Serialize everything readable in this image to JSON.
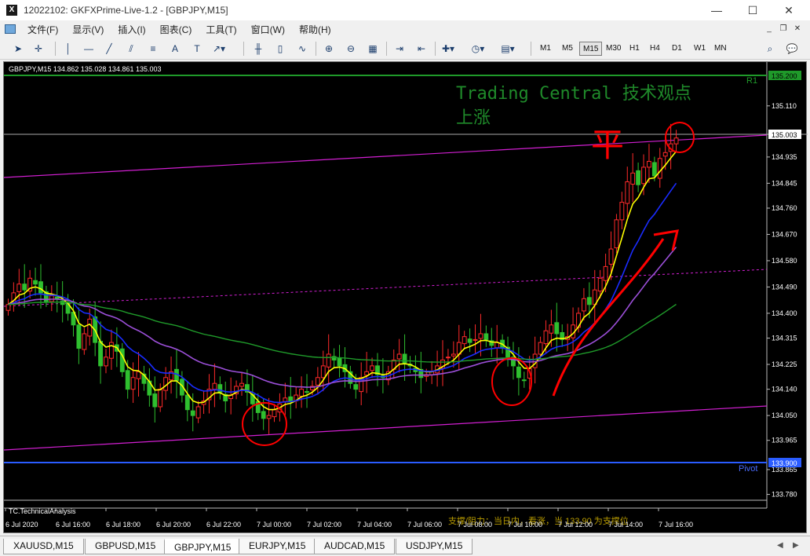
{
  "window": {
    "title": "12022102: GKFXPrime-Live-1.2 - [GBPJPY,M15]",
    "app_icon": "X",
    "minimize": "—",
    "maximize": "☐",
    "close": "✕"
  },
  "menu": [
    "文件(F)",
    "显示(V)",
    "插入(I)",
    "图表(C)",
    "工具(T)",
    "窗口(W)",
    "帮助(H)"
  ],
  "toolbar": {
    "timeframes": [
      "M1",
      "M5",
      "M15",
      "M30",
      "H1",
      "H4",
      "D1",
      "W1",
      "MN"
    ],
    "active_timeframe": "M15",
    "tool_labels": [
      "A",
      "T"
    ]
  },
  "chart": {
    "symbol_line": "GBPJPY,M15  134.862 135.028 134.861 135.003",
    "overlay_title": "Trading Central 技术观点",
    "overlay_subtitle": "上涨",
    "handwritten_note": "平",
    "indicator_label": "TC.TechnicalAnalysis",
    "bottom_overlay_text": "支撑/阻力：当日内，看涨，当 133.90 为支撑位",
    "r1_label": "R1",
    "r1_value": "135.200",
    "pivot_label": "Pivot",
    "pivot_value": "133.900",
    "current_price": "135.003",
    "colors": {
      "background": "#000000",
      "candle_up": "#ff2a2a",
      "candle_down": "#2fbf2f",
      "ma_fast": "#ffff00",
      "ma_mid": "#1a2cff",
      "ma_slow": "#9b4fd8",
      "ma_long": "#1f9a2a",
      "channel": "#d21fd2",
      "r1_line": "#1f9a2a",
      "pivot_line": "#2a5cff",
      "annotation": "#ff0000",
      "overlay_text": "#1f8a2a"
    }
  },
  "chart_data": {
    "type": "candlestick",
    "title": "GBPJPY,M15",
    "y_ticks": [
      "135.110",
      "134.935",
      "134.845",
      "134.760",
      "134.670",
      "134.580",
      "134.490",
      "134.400",
      "134.315",
      "134.225",
      "134.140",
      "134.050",
      "133.965",
      "133.865",
      "133.780"
    ],
    "x_ticks": [
      "6 Jul 2020",
      "6 Jul 16:00",
      "6 Jul 18:00",
      "6 Jul 20:00",
      "6 Jul 22:00",
      "7 Jul 00:00",
      "7 Jul 02:00",
      "7 Jul 04:00",
      "7 Jul 06:00",
      "7 Jul 08:00",
      "7 Jul 10:00",
      "7 Jul 12:00",
      "7 Jul 14:00",
      "7 Jul 16:00"
    ],
    "ylim": [
      133.76,
      135.26
    ],
    "last_close": 135.003,
    "levels": [
      {
        "name": "R1",
        "value": 135.2
      },
      {
        "name": "Pivot",
        "value": 133.9
      }
    ],
    "closes": [
      134.43,
      134.47,
      134.5,
      134.48,
      134.52,
      134.5,
      134.47,
      134.44,
      134.46,
      134.45,
      134.43,
      134.4,
      134.36,
      134.28,
      134.33,
      134.38,
      134.3,
      134.22,
      134.25,
      134.3,
      134.27,
      134.2,
      134.14,
      134.18,
      134.2,
      134.16,
      134.12,
      134.08,
      134.14,
      134.18,
      134.2,
      134.17,
      134.12,
      134.07,
      134.05,
      134.08,
      134.1,
      134.14,
      134.16,
      134.13,
      134.1,
      134.12,
      134.15,
      134.16,
      134.13,
      134.09,
      134.06,
      134.04,
      134.05,
      134.07,
      134.09,
      134.11,
      134.1,
      134.12,
      134.14,
      134.13,
      134.15,
      134.18,
      134.22,
      134.26,
      134.24,
      134.22,
      134.2,
      134.16,
      134.14,
      134.18,
      134.2,
      134.22,
      134.19,
      134.18,
      134.2,
      134.24,
      134.26,
      134.23,
      134.22,
      134.2,
      134.18,
      134.19,
      134.2,
      134.22,
      134.24,
      134.25,
      134.26,
      134.3,
      134.32,
      134.3,
      134.31,
      134.33,
      134.31,
      134.29,
      134.3,
      134.28,
      134.25,
      134.22,
      134.18,
      134.17,
      134.21,
      134.26,
      134.3,
      134.34,
      134.36,
      134.33,
      134.31,
      134.32,
      134.36,
      134.4,
      134.45,
      134.43,
      134.48,
      134.52,
      134.56,
      134.62,
      134.72,
      134.78,
      134.85,
      134.88,
      134.84,
      134.9,
      134.92,
      134.87,
      134.93,
      134.95,
      134.98,
      135.0
    ]
  },
  "symbol_tabs": [
    "XAUUSD,M15",
    "GBPUSD,M15",
    "GBPJPY,M15",
    "EURJPY,M15",
    "AUDCAD,M15",
    "USDJPY,M15"
  ],
  "active_symbol_tab": "GBPJPY,M15"
}
